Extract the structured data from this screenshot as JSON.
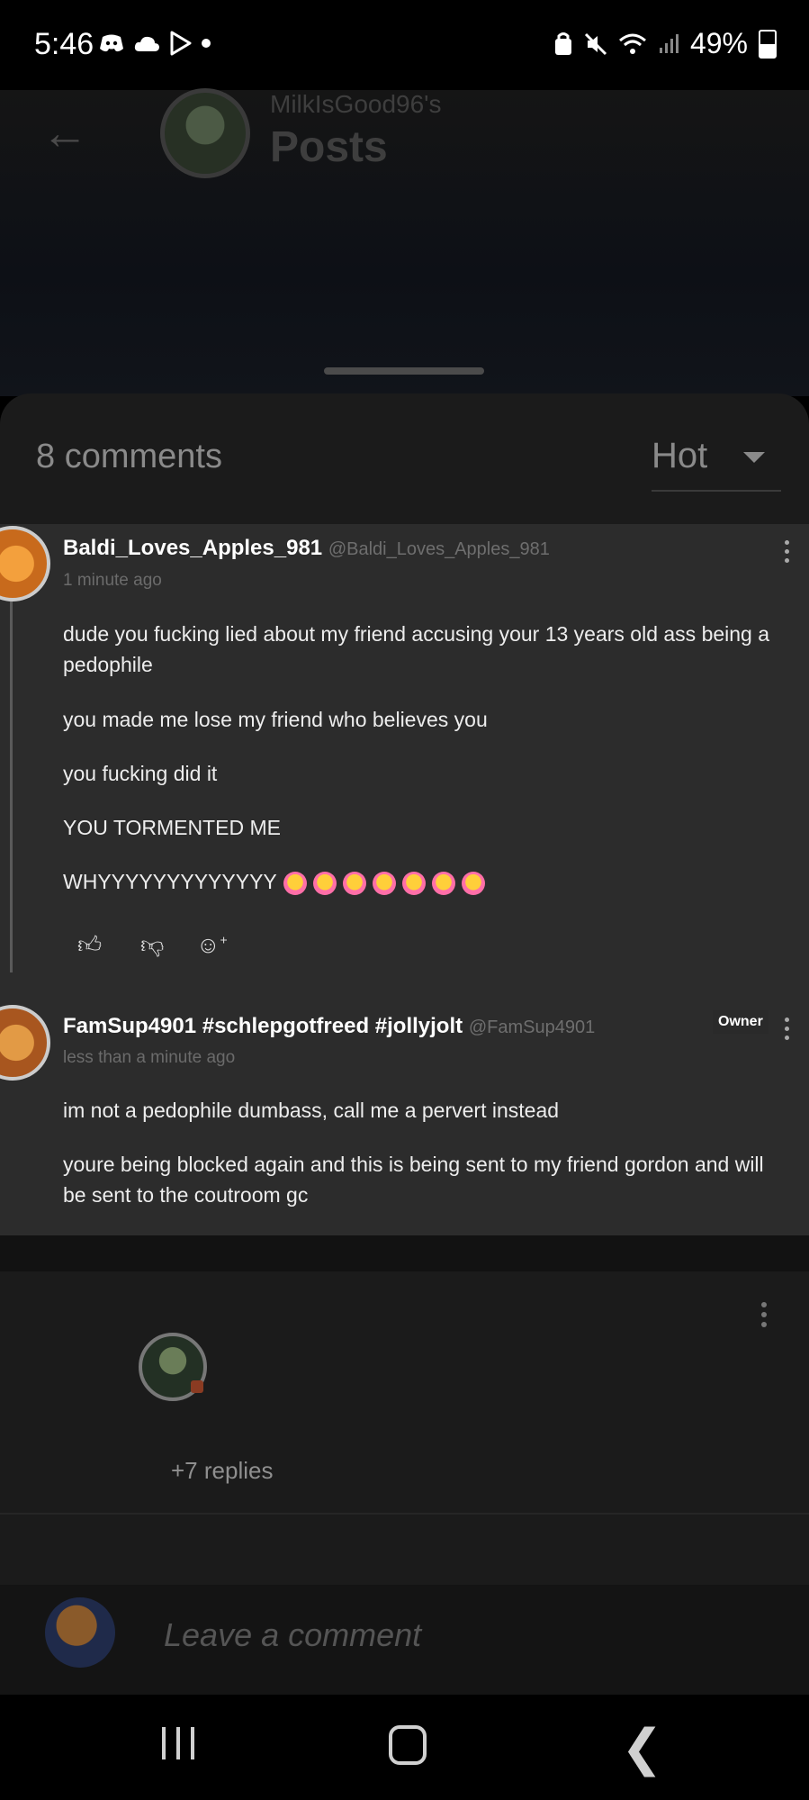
{
  "status_bar": {
    "time": "5:46",
    "battery_text": "49%",
    "left_icons": [
      "discord-icon",
      "cloud-icon",
      "play-store-icon",
      "dot-icon"
    ],
    "right_icons": [
      "lock-sync-icon",
      "mute-icon",
      "wifi-icon",
      "signal-icon",
      "battery-icon"
    ]
  },
  "header": {
    "username": "MilkIsGood96's",
    "title": "Posts"
  },
  "comments_section": {
    "count_label": "8 comments",
    "sort_selected": "Hot"
  },
  "comments": [
    {
      "username": "Baldi_Loves_Apples_981",
      "handle": "@Baldi_Loves_Apples_981",
      "time": "1 minute ago",
      "paragraphs": [
        "dude you fucking lied about my friend accusing your 13 years old ass being a pedophile",
        "you made me lose my friend who believes you",
        "you fucking did it",
        "YOU TORMENTED ME",
        "WHYYYYYYYYYYYYY"
      ],
      "emoji_count": 7
    },
    {
      "username": "FamSup4901 #schlepgotfreed #jollyjolt",
      "handle": "@FamSup4901",
      "badge": "Owner",
      "time": "less than a minute ago",
      "paragraphs": [
        "im not a pedophile dumbass, call me a pervert instead",
        "youre being blocked again and this is being sent to my friend gordon and will be sent to the coutroom gc"
      ]
    }
  ],
  "thread": {
    "replies_label": "+7 replies"
  },
  "composer": {
    "placeholder": "Leave a comment"
  },
  "colors": {
    "sheet_bg": "#1b1b1b",
    "card_bg": "#2c2c2c",
    "muted_text": "#8a8a8a"
  }
}
